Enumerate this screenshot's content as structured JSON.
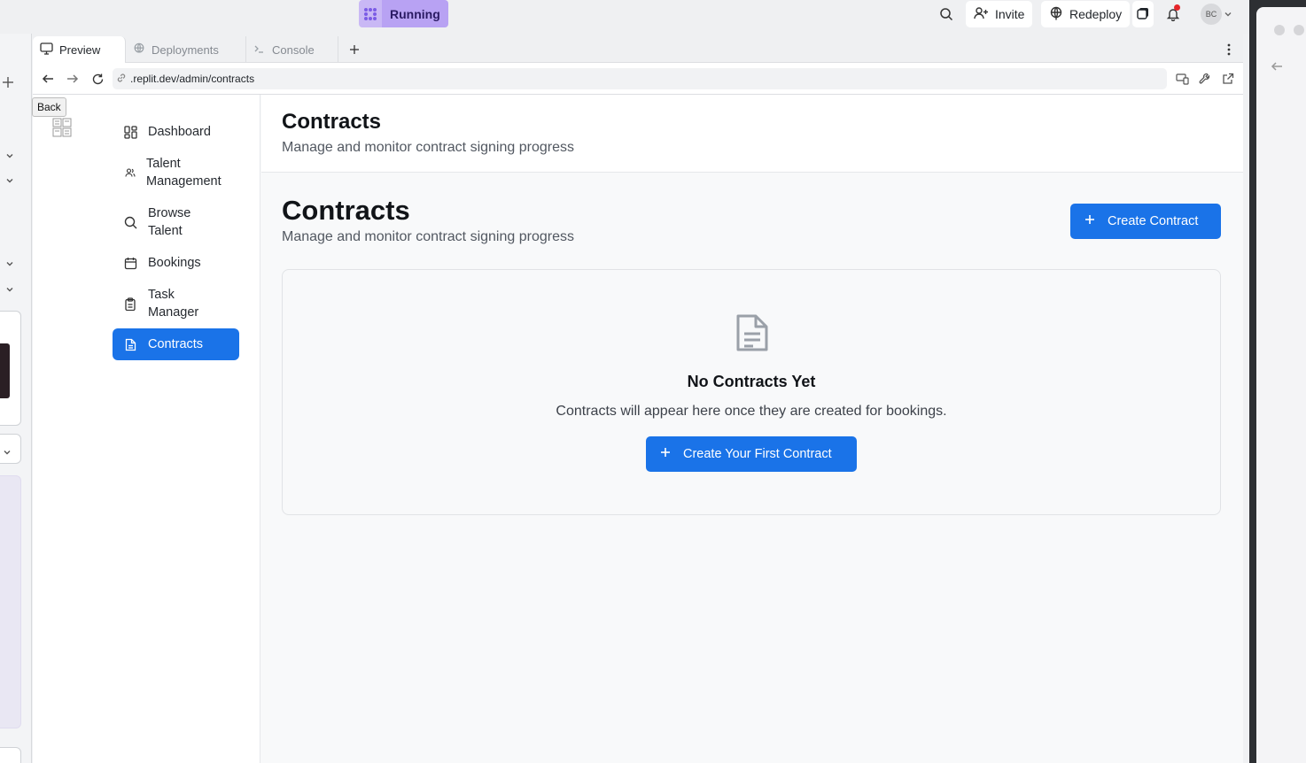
{
  "topbar": {
    "status_label": "Running",
    "invite_label": "Invite",
    "redeploy_label": "Redeploy",
    "user_initials": "BC"
  },
  "tabs": [
    {
      "label": "Preview"
    },
    {
      "label": "Deployments"
    },
    {
      "label": "Console"
    }
  ],
  "urlbar": {
    "url": ".replit.dev/admin/contracts",
    "tooltip": "Back"
  },
  "sidebar": {
    "items": [
      {
        "label": "Dashboard"
      },
      {
        "label": "Talent Management"
      },
      {
        "label": "Browse Talent"
      },
      {
        "label": "Bookings"
      },
      {
        "label": "Task Manager"
      },
      {
        "label": "Contracts"
      }
    ]
  },
  "header": {
    "title": "Contracts",
    "subtitle": "Manage and monitor contract signing progress"
  },
  "main": {
    "title": "Contracts",
    "subtitle": "Manage and monitor contract signing progress",
    "create_button": "Create Contract",
    "empty_title": "No Contracts Yet",
    "empty_text": "Contracts will appear here once they are created for bookings.",
    "empty_button": "Create Your First Contract"
  },
  "colors": {
    "primary": "#1a73e8",
    "running_badge": "#b8a2f3",
    "notification_dot": "#e5252a"
  }
}
